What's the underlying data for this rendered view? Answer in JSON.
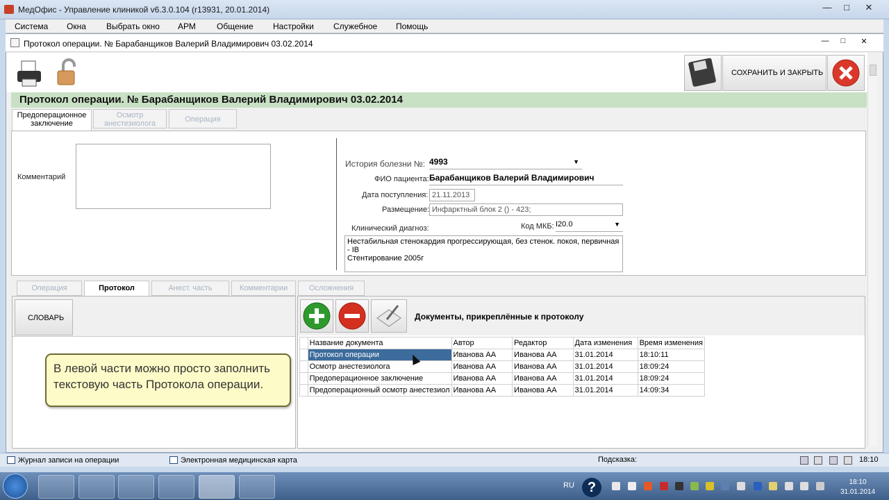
{
  "app": {
    "title": "МедОфис - Управление клиникой v6.3.0.104 (r13931, 20.01.2014)"
  },
  "menu": [
    "Система",
    "Окна",
    "Выбрать окно",
    "АРМ",
    "Общение",
    "Настройки",
    "Служебное",
    "Помощь"
  ],
  "window": {
    "title": "Протокол операции. №  Барабанщиков Валерий Владимирович 03.02.2014"
  },
  "toolbar": {
    "save_close": "СОХРАНИТЬ И ЗАКРЫТЬ"
  },
  "header": {
    "title": "Протокол операции. №  Барабанщиков Валерий Владимирович 03.02.2014"
  },
  "tabs": [
    {
      "label": "Предоперационное заключение",
      "active": true
    },
    {
      "label": "Осмотр анестезиолога",
      "active": false
    },
    {
      "label": "Операция",
      "active": false
    }
  ],
  "form": {
    "comment_label": "Комментарий",
    "history_label": "История болезни №:",
    "history_value": "4993",
    "fio_label": "ФИО пациента:",
    "fio_value": "Барабанщиков Валерий Владимирович",
    "admission_label": "Дата поступления:",
    "admission_value": "21.11.2013",
    "placement_label": "Размещение:",
    "placement_value": "Инфарктный блок 2 ()  - 423;",
    "diagnosis_label": "Клинический диагноз:",
    "mkb_label": "Код МКБ:",
    "mkb_value": "I20.0",
    "diagnosis_line1": "Нестабильная стенокардия прогрессирующая, без стенок. покоя, первичная - IB",
    "diagnosis_line2": "Стентирование  2005г"
  },
  "tabs2": [
    {
      "label": "Операция",
      "active": false
    },
    {
      "label": "Протокол",
      "active": true
    },
    {
      "label": "Анест. часть",
      "active": false
    },
    {
      "label": "Комментарии",
      "active": false
    },
    {
      "label": "Осложнения",
      "active": false
    }
  ],
  "dictionary_button": "СЛОВАРЬ",
  "tooltip": {
    "line1": "В левой части можно просто заполнить",
    "line2": "текстовую часть Протокола операции."
  },
  "docs": {
    "title": "Документы, прикреплённые к протоколу",
    "headers": [
      "Название документа",
      "Автор",
      "Редактор",
      "Дата изменения",
      "Время изменения"
    ],
    "rows": [
      [
        "Протокол операции",
        "Иванова АА",
        "Иванова АА",
        "31.01.2014",
        "18:10:11"
      ],
      [
        "Осмотр анестезиолога",
        "Иванова АА",
        "Иванова АА",
        "31.01.2014",
        "18:09:24"
      ],
      [
        "Предоперационное заключение",
        "Иванова АА",
        "Иванова АА",
        "31.01.2014",
        "18:09:24"
      ],
      [
        "Предоперационный осмотр анестезиол",
        "Иванова АА",
        "Иванова АА",
        "31.01.2014",
        "14:09:34"
      ]
    ]
  },
  "status": {
    "item1": "Журнал записи на операции",
    "item2": "Электронная медицинская карта",
    "hint": "Подсказка:",
    "time": "18:10"
  },
  "taskbar": {
    "lang": "RU",
    "time": "18:10",
    "date": "31.01.2014"
  }
}
